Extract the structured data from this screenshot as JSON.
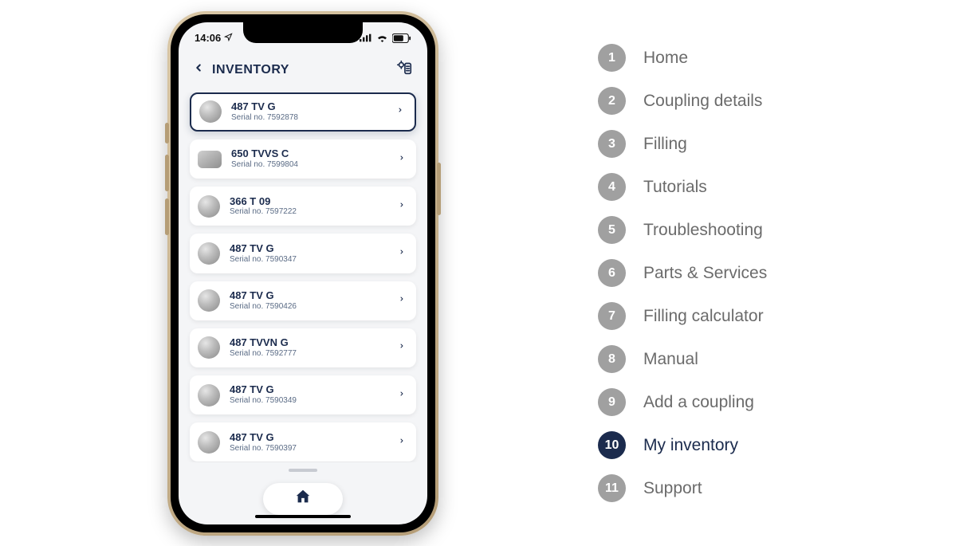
{
  "statusbar": {
    "time": "14:06"
  },
  "appbar": {
    "title": "INVENTORY"
  },
  "items": [
    {
      "title": "487 TV G",
      "sub": "Serial no. 7592878",
      "selected": true,
      "shape": "round"
    },
    {
      "title": "650 TVVS C",
      "sub": "Serial no. 7599804",
      "selected": false,
      "shape": "wide"
    },
    {
      "title": "366 T 09",
      "sub": "Serial no. 7597222",
      "selected": false,
      "shape": "round"
    },
    {
      "title": "487 TV G",
      "sub": "Serial no. 7590347",
      "selected": false,
      "shape": "round"
    },
    {
      "title": "487 TV G",
      "sub": "Serial no. 7590426",
      "selected": false,
      "shape": "round"
    },
    {
      "title": "487 TVVN G",
      "sub": "Serial no. 7592777",
      "selected": false,
      "shape": "round"
    },
    {
      "title": "487 TV G",
      "sub": "Serial no. 7590349",
      "selected": false,
      "shape": "round"
    },
    {
      "title": "487 TV G",
      "sub": "Serial no. 7590397",
      "selected": false,
      "shape": "round"
    }
  ],
  "legend": [
    {
      "num": "1",
      "label": "Home",
      "active": false
    },
    {
      "num": "2",
      "label": "Coupling details",
      "active": false
    },
    {
      "num": "3",
      "label": "Filling",
      "active": false
    },
    {
      "num": "4",
      "label": "Tutorials",
      "active": false
    },
    {
      "num": "5",
      "label": "Troubleshooting",
      "active": false
    },
    {
      "num": "6",
      "label": "Parts & Services",
      "active": false
    },
    {
      "num": "7",
      "label": "Filling calculator",
      "active": false
    },
    {
      "num": "8",
      "label": "Manual",
      "active": false
    },
    {
      "num": "9",
      "label": "Add a coupling",
      "active": false
    },
    {
      "num": "10",
      "label": "My inventory",
      "active": true
    },
    {
      "num": "11",
      "label": "Support",
      "active": false
    }
  ]
}
